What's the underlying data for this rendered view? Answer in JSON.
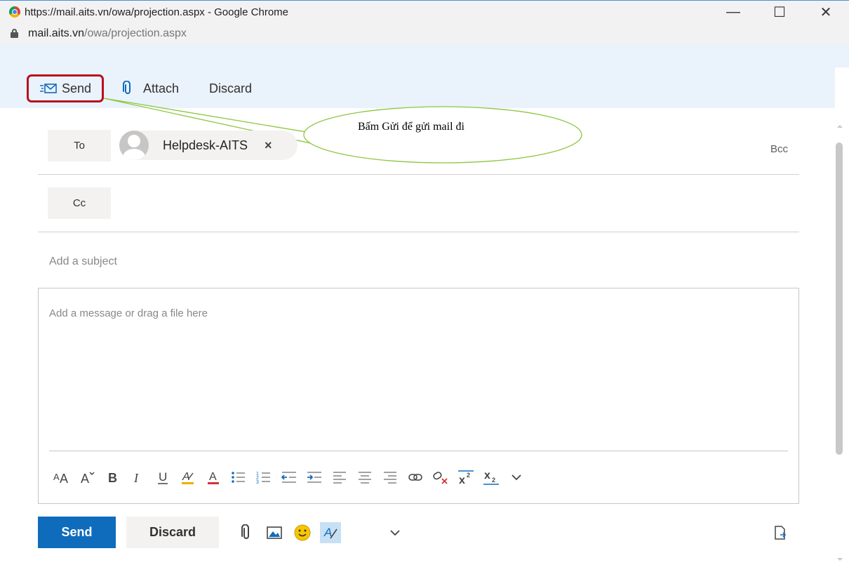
{
  "window": {
    "title": "https://mail.aits.vn/owa/projection.aspx - Google Chrome",
    "url_host": "mail.aits.vn",
    "url_path": "/owa/projection.aspx",
    "controls": {
      "minimize": "—",
      "maximize": "☐",
      "close": "✕"
    }
  },
  "toolbar": {
    "send_label": "Send",
    "attach_label": "Attach",
    "discard_label": "Discard"
  },
  "callout": {
    "text": "Bấm Gửi để gửi mail đi"
  },
  "recipients": {
    "to_label": "To",
    "cc_label": "Cc",
    "bcc_label": "Bcc",
    "to_chips": [
      {
        "name": "Helpdesk-AITS",
        "remove": "×"
      }
    ]
  },
  "compose": {
    "subject_placeholder": "Add a subject",
    "body_placeholder": "Add a message or drag a file here"
  },
  "format_bar": {
    "items": [
      {
        "name": "font-size-icon",
        "glyph": "ᴬA"
      },
      {
        "name": "grow-font-icon",
        "glyph": "Aˇ"
      },
      {
        "name": "bold-icon",
        "glyph": "B"
      },
      {
        "name": "italic-icon",
        "glyph": "I"
      },
      {
        "name": "underline-icon",
        "glyph": "U"
      },
      {
        "name": "highlight-icon",
        "glyph": "A"
      },
      {
        "name": "font-color-icon",
        "glyph": "A"
      },
      {
        "name": "bullets-icon",
        "glyph": "☰"
      },
      {
        "name": "numbering-icon",
        "glyph": "☰"
      },
      {
        "name": "decrease-indent-icon",
        "glyph": "⇤"
      },
      {
        "name": "increase-indent-icon",
        "glyph": "⇥"
      },
      {
        "name": "align-left-icon",
        "glyph": "≡"
      },
      {
        "name": "align-center-icon",
        "glyph": "≡"
      },
      {
        "name": "align-right-icon",
        "glyph": "≡"
      },
      {
        "name": "link-icon",
        "glyph": "∞"
      },
      {
        "name": "unlink-icon",
        "glyph": "∞"
      },
      {
        "name": "superscript-icon",
        "glyph": "x²"
      },
      {
        "name": "subscript-icon",
        "glyph": "x₂"
      },
      {
        "name": "more-options-icon",
        "glyph": "⌄"
      }
    ]
  },
  "footer": {
    "send_label": "Send",
    "discard_label": "Discard"
  },
  "colors": {
    "accent": "#0f6cbd",
    "ribbon_bg": "#eaf2fb",
    "highlight_box": "#b80f1c",
    "callout_stroke": "#8cc63f"
  }
}
